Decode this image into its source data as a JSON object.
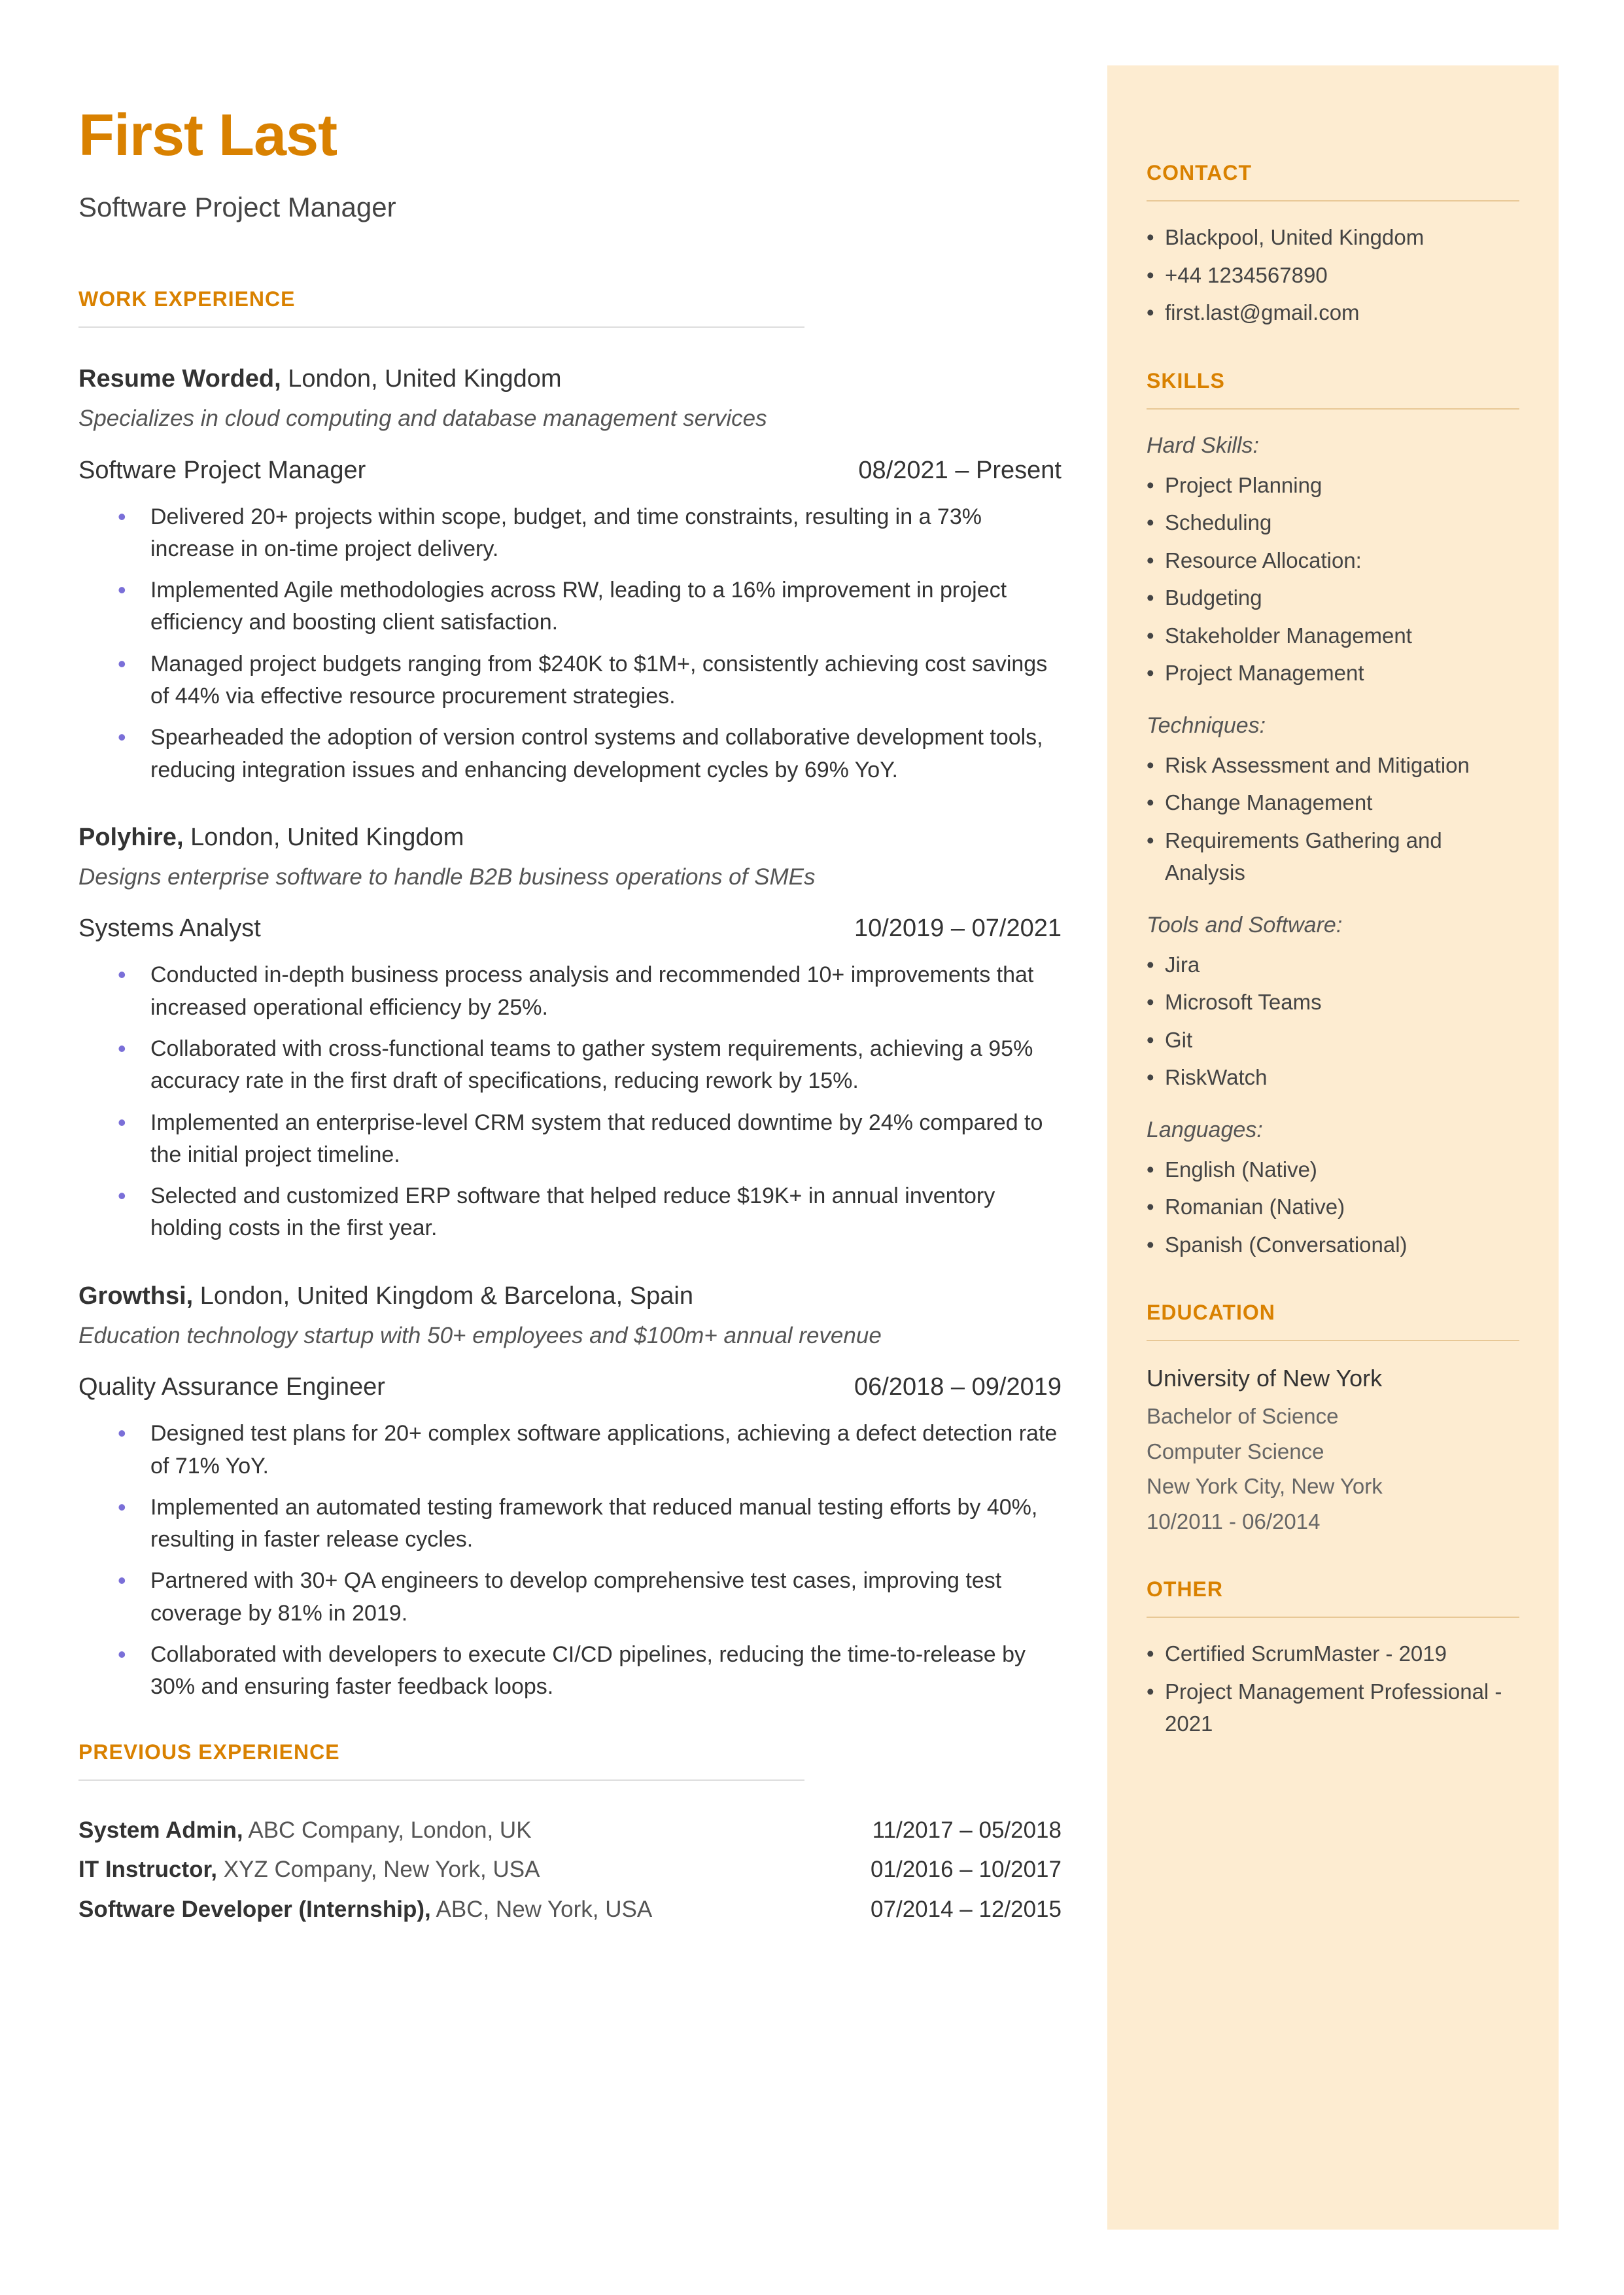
{
  "header": {
    "name": "First Last",
    "title": "Software Project Manager"
  },
  "sections": {
    "work_experience": "WORK EXPERIENCE",
    "previous_experience": "PREVIOUS EXPERIENCE",
    "contact": "CONTACT",
    "skills": "SKILLS",
    "education": "EDUCATION",
    "other": "OTHER"
  },
  "experience": [
    {
      "company": "Resume Worded,",
      "location": "London, United Kingdom",
      "description": "Specializes in cloud computing and database management services",
      "role": "Software Project Manager",
      "dates": "08/2021 – Present",
      "bullets": [
        "Delivered 20+ projects within scope, budget, and time constraints, resulting in a 73% increase in on-time project delivery.",
        "Implemented Agile methodologies across RW, leading to a 16% improvement in project efficiency and boosting client satisfaction.",
        "Managed project budgets ranging from $240K to $1M+, consistently achieving cost savings of 44% via effective resource procurement strategies.",
        "Spearheaded the adoption of version control systems and collaborative development tools, reducing integration issues and enhancing development cycles by 69% YoY."
      ]
    },
    {
      "company": "Polyhire,",
      "location": "London, United Kingdom",
      "description": "Designs enterprise software to handle B2B business operations of SMEs",
      "role": "Systems Analyst",
      "dates": "10/2019 – 07/2021",
      "bullets": [
        "Conducted in-depth business process analysis and recommended 10+ improvements that increased operational efficiency by 25%.",
        "Collaborated with cross-functional teams to gather system requirements, achieving a 95% accuracy rate in the first draft of specifications, reducing rework by 15%.",
        "Implemented an enterprise-level CRM system that reduced downtime by 24% compared to the initial project timeline.",
        "Selected and customized ERP software that helped reduce $19K+ in annual inventory holding costs in the first year."
      ]
    },
    {
      "company": "Growthsi,",
      "location": "London, United Kingdom & Barcelona, Spain",
      "description": "Education technology startup with 50+ employees and $100m+ annual revenue",
      "role": "Quality Assurance Engineer",
      "dates": "06/2018 – 09/2019",
      "bullets": [
        "Designed test plans for 20+ complex software applications, achieving a defect detection rate of 71% YoY.",
        "Implemented an automated testing framework that reduced manual testing efforts by 40%, resulting in faster release cycles.",
        "Partnered with 30+ QA engineers to develop comprehensive test cases, improving test coverage by 81% in 2019.",
        "Collaborated with developers to execute CI/CD pipelines, reducing the time-to-release by 30% and ensuring faster feedback loops."
      ]
    }
  ],
  "previous": [
    {
      "title": "System Admin,",
      "company": "ABC Company, London, UK",
      "dates": "11/2017 – 05/2018"
    },
    {
      "title": "IT Instructor,",
      "company": "XYZ Company, New York, USA",
      "dates": "01/2016 – 10/2017"
    },
    {
      "title": "Software Developer (Internship),",
      "company": "ABC, New York, USA",
      "dates": "07/2014 – 12/2015"
    }
  ],
  "contact": [
    "Blackpool, United Kingdom",
    "+44 1234567890",
    "first.last@gmail.com"
  ],
  "skills": {
    "hard_label": "Hard Skills:",
    "hard": [
      "Project Planning",
      "Scheduling",
      "Resource Allocation:",
      "Budgeting",
      "Stakeholder Management",
      "Project Management"
    ],
    "tech_label": "Techniques:",
    "tech": [
      "Risk Assessment and Mitigation",
      "Change Management",
      "Requirements Gathering and Analysis"
    ],
    "tools_label": "Tools and Software:",
    "tools": [
      "Jira",
      "Microsoft Teams",
      "Git",
      "RiskWatch"
    ],
    "lang_label": "Languages:",
    "lang": [
      "English (Native)",
      "Romanian (Native)",
      "Spanish (Conversational)"
    ]
  },
  "education": {
    "school": "University of New York",
    "degree": "Bachelor of Science",
    "field": "Computer Science",
    "location": "New York City, New York",
    "dates": "10/2011 - 06/2014"
  },
  "other": [
    "Certified ScrumMaster - 2019",
    "Project Management Professional - 2021"
  ]
}
